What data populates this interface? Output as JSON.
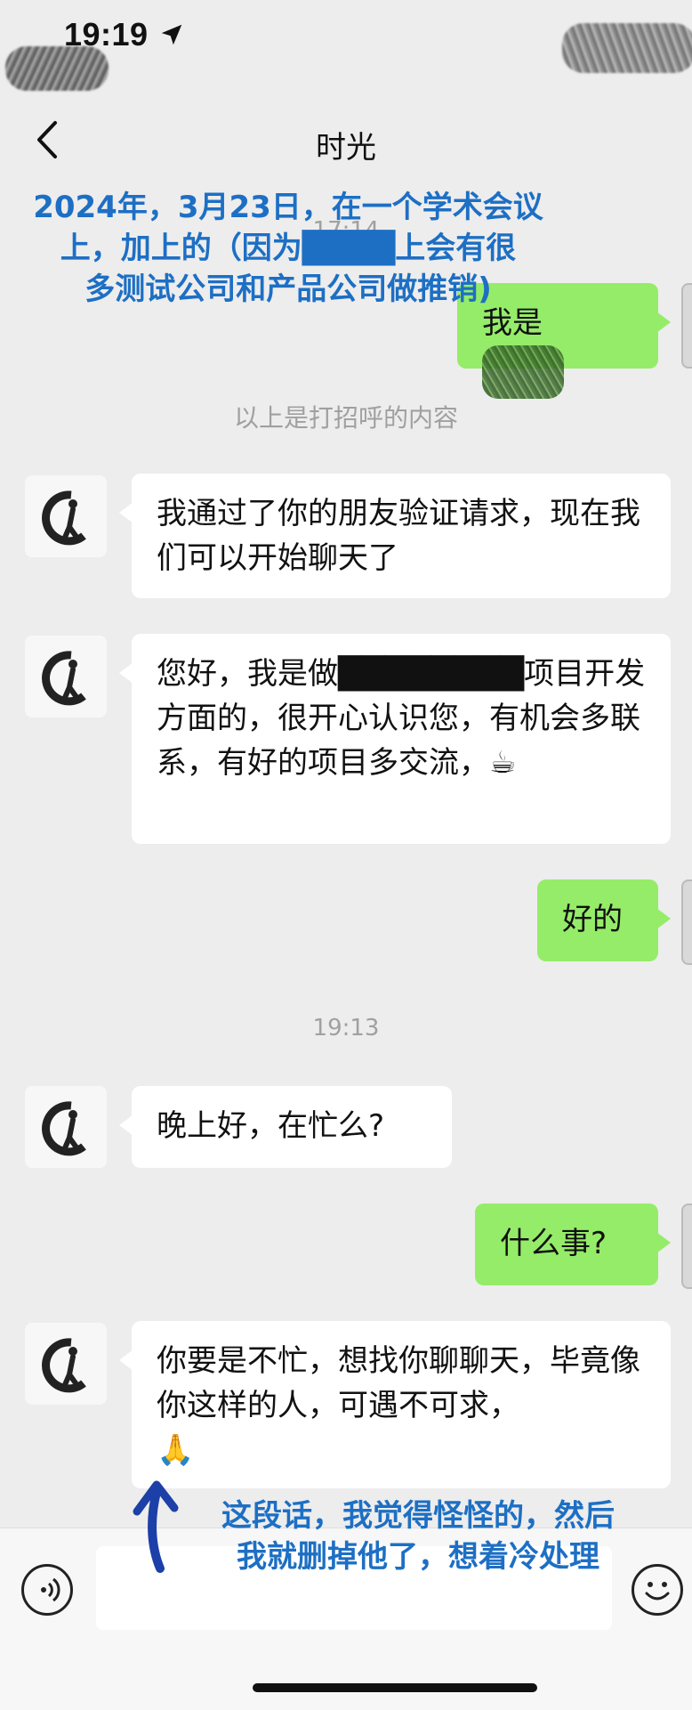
{
  "status": {
    "time": "19:19"
  },
  "header": {
    "title": "时光"
  },
  "annotations": {
    "top": [
      "2024年，3月23日，在一个学术会议",
      "上，加上的（因为████上会有很",
      "多测试公司和产品公司做推销)"
    ],
    "bottom": [
      "这段话，我觉得怪怪的，然后",
      "我就删掉他了，想着冷处理"
    ]
  },
  "chat": {
    "timestamp1": "17:14",
    "msg_me_1": "我是",
    "system_note": "以上是打招呼的内容",
    "msg_them_1": "我通过了你的朋友验证请求，现在我们可以开始聊天了",
    "msg_them_2": "您好，我是做████████项目开发方面的，很开心认识您，有机会多联系，有好的项目多交流，",
    "msg_them_2_emoji": "☕",
    "msg_me_2": "好的",
    "timestamp2": "19:13",
    "msg_them_3": "晚上好，在忙么?",
    "msg_me_3": "什么事?",
    "msg_them_4": "你要是不忙，想找你聊聊天，毕竟像你这样的人，可遇不可求，",
    "msg_them_4_emoji": "🙏"
  },
  "icons": {
    "back": "chevron-left-icon",
    "location": "location-arrow-icon",
    "voice": "voice-icon",
    "emoji": "smiley-icon"
  },
  "colors": {
    "my_bubble": "#95ec69",
    "their_bubble": "#ffffff",
    "annotation": "#1d6fc4",
    "background": "#ededed"
  }
}
